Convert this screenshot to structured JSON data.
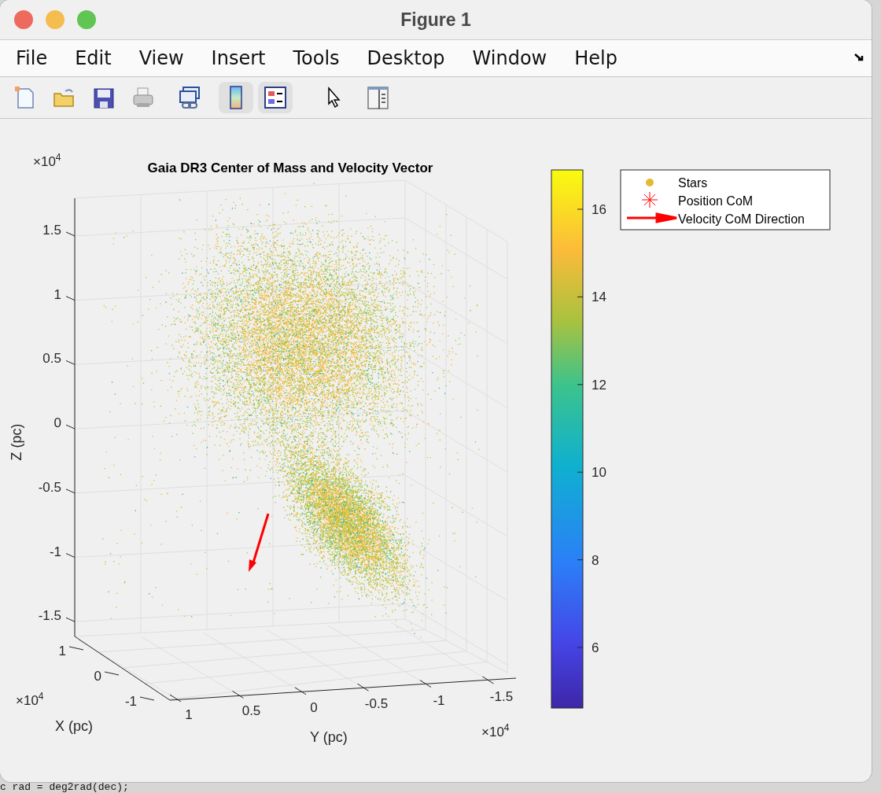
{
  "window": {
    "title": "Figure 1"
  },
  "menu": [
    {
      "label": "File"
    },
    {
      "label": "Edit"
    },
    {
      "label": "View"
    },
    {
      "label": "Insert"
    },
    {
      "label": "Tools"
    },
    {
      "label": "Desktop"
    },
    {
      "label": "Window"
    },
    {
      "label": "Help"
    }
  ],
  "toolbar": [
    {
      "kind": "new",
      "on": false
    },
    {
      "kind": "open",
      "on": false
    },
    {
      "kind": "save",
      "on": false
    },
    {
      "kind": "print",
      "on": false
    },
    {
      "kind": "link",
      "on": false
    },
    {
      "kind": "colorbar",
      "on": true
    },
    {
      "kind": "legend",
      "on": true
    },
    {
      "kind": "pointer",
      "on": false
    },
    {
      "kind": "inspector",
      "on": false
    }
  ],
  "plot": {
    "title": "Gaia DR3 Center of Mass and Velocity Vector",
    "z_label": "Z (pc)",
    "x_label": "X (pc)",
    "y_label": "Y (pc)",
    "z_ticks": [
      "1.5",
      "1",
      "0.5",
      "0",
      "-0.5",
      "-1",
      "-1.5"
    ],
    "x_ticks": [
      "1",
      "0",
      "-1"
    ],
    "y_ticks": [
      "1",
      "0.5",
      "0",
      "-0.5",
      "-1",
      "-1.5"
    ],
    "z_exponent": {
      "base": "×10",
      "power": "4"
    },
    "x_exponent": {
      "base": "×10",
      "power": "4"
    },
    "y_exponent": {
      "base": "×10",
      "power": "4"
    }
  },
  "colorbar": {
    "ticks": [
      "16",
      "14",
      "12",
      "10",
      "8",
      "6"
    ]
  },
  "legend": [
    {
      "kind": "marker",
      "label": "Stars"
    },
    {
      "kind": "star",
      "label": "Position CoM"
    },
    {
      "kind": "arrow",
      "label": "Velocity CoM Direction"
    }
  ],
  "background_code": "c rad = deg2rad(dec);"
}
